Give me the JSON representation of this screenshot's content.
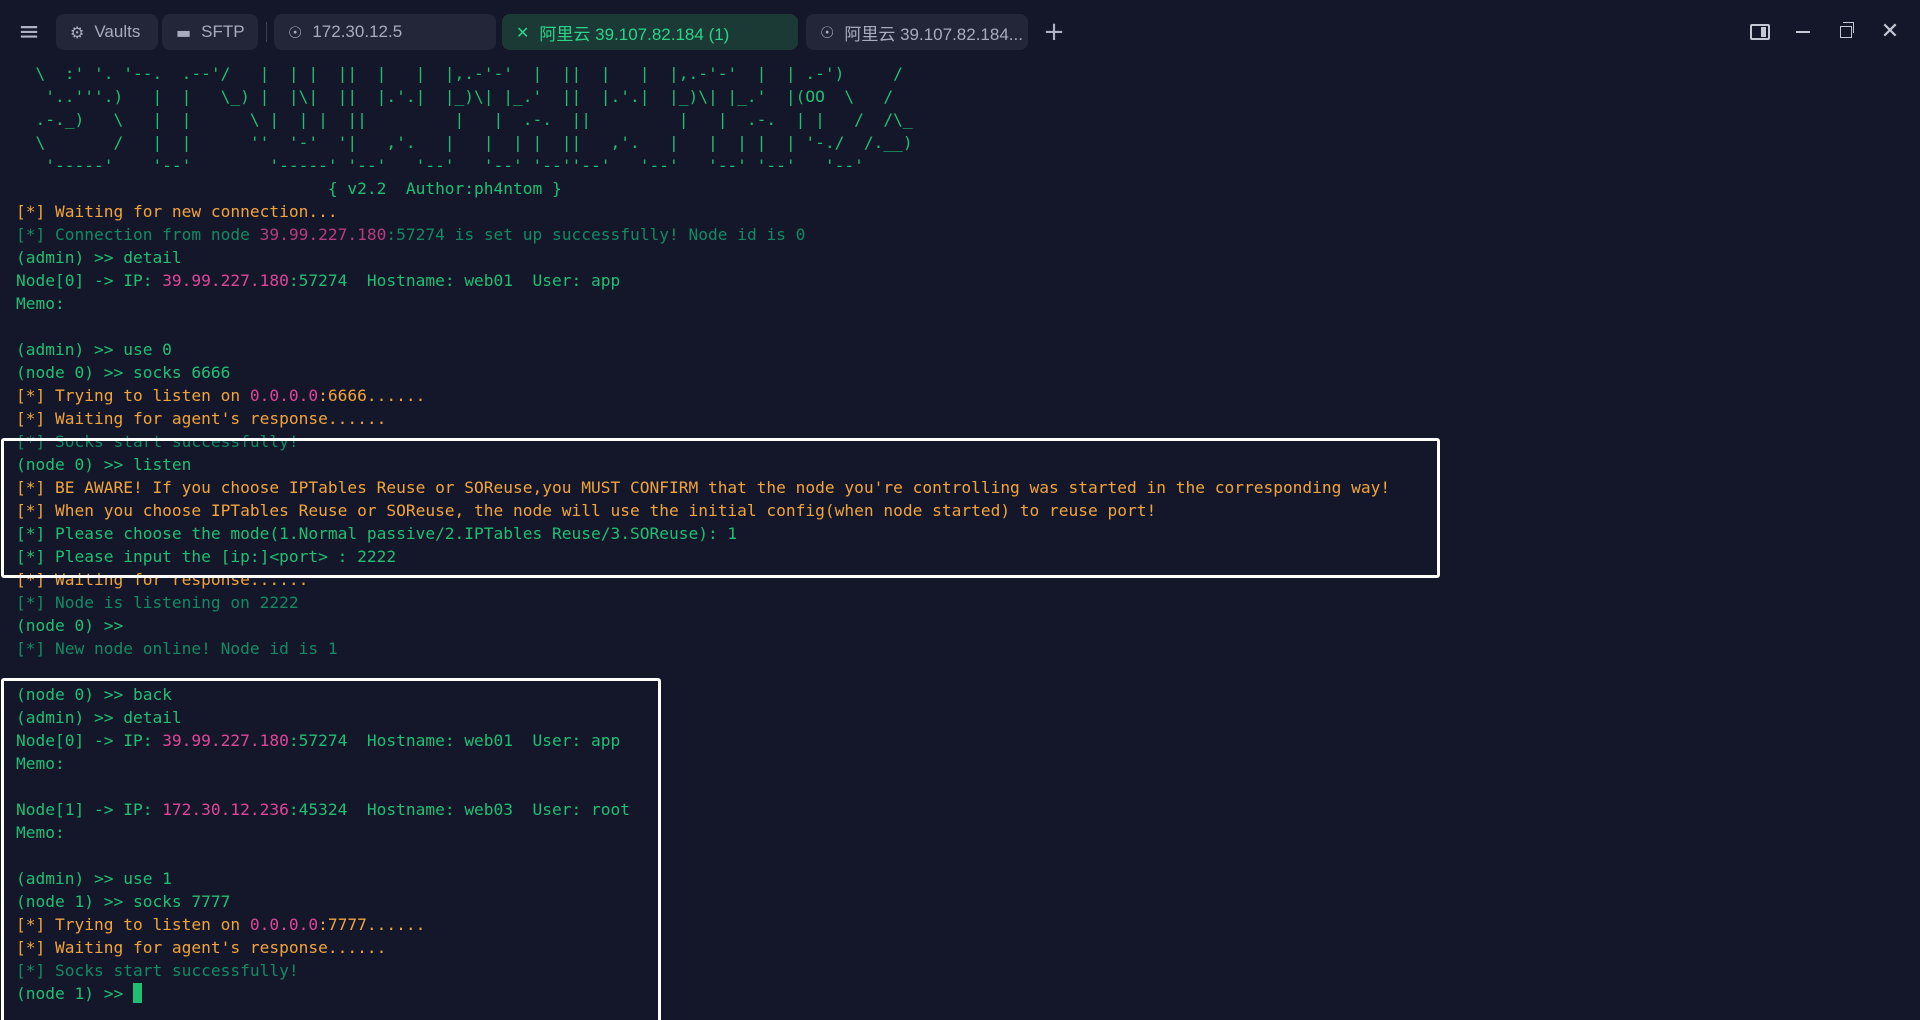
{
  "tabs": [
    {
      "label": "Vaults",
      "icon": "vault-icon"
    },
    {
      "label": "SFTP",
      "icon": "folder-icon"
    },
    {
      "label": "172.30.12.5",
      "icon": "linux-icon"
    },
    {
      "label": "阿里云 39.107.82.184 (1)",
      "icon": "close-icon",
      "active": true
    },
    {
      "label": "阿里云 39.107.82.184...",
      "icon": "linux-icon"
    }
  ],
  "banner": [
    "  \\  :' '. '--.  .--'/   |  | |  ||  |   |  |,.-'-'  |  ||  |   |  |,.-'-'  |  | .-')     /",
    "   '..'''.)   |  |   \\_) |  |\\|  ||  |.'.|  |_)\\| |_.'  ||  |.'.|  |_)\\| |_.'  |(OO  \\   /",
    "  .-._)   \\   |  |      \\ |  | |  ||         |   |  .-.  ||         |   |  .-.  | |   /  /\\_",
    "  \\       /   |  |      ''  '-'  '|   ,'.   |   |  | |  ||   ,'.   |   |  | |  | '-./  /.__)",
    "   '-----'    '--'        '-----' '--'   '--'   '--' '--''--'   '--'   '--' '--'   '--'"
  ],
  "version_line": "                                { v2.2  Author:ph4ntom }",
  "lines": [
    {
      "segments": [
        {
          "t": "[*] Waiting for new connection...",
          "c": "warn"
        }
      ]
    },
    {
      "segments": [
        {
          "t": "[*] Connection from node ",
          "c": "dim"
        },
        {
          "t": "39.99.227.180",
          "c": "ip-dim"
        },
        {
          "t": ":57274 is set up successfully! Node id is 0",
          "c": "dim"
        }
      ]
    },
    {
      "segments": [
        {
          "t": "(admin) >> detail",
          "c": ""
        }
      ]
    },
    {
      "segments": [
        {
          "t": "Node[0] -> IP: ",
          "c": ""
        },
        {
          "t": "39.99.227.180",
          "c": "ip"
        },
        {
          "t": ":57274  Hostname: web01  User: app",
          "c": ""
        }
      ]
    },
    {
      "segments": [
        {
          "t": "Memo:",
          "c": ""
        }
      ]
    },
    {
      "segments": [
        {
          "t": "",
          "c": ""
        }
      ]
    },
    {
      "segments": [
        {
          "t": "(admin) >> use 0",
          "c": ""
        }
      ]
    },
    {
      "segments": [
        {
          "t": "(node 0) >> socks 6666",
          "c": ""
        }
      ]
    },
    {
      "segments": [
        {
          "t": "[*] Trying to listen on ",
          "c": "warn"
        },
        {
          "t": "0.0.0.0",
          "c": "addr"
        },
        {
          "t": ":6666......",
          "c": "warn"
        }
      ]
    },
    {
      "segments": [
        {
          "t": "[*] Waiting for agent's response......",
          "c": "warn"
        }
      ]
    },
    {
      "segments": [
        {
          "t": "[*] Socks start successfully!",
          "c": "dim"
        }
      ]
    },
    {
      "segments": [
        {
          "t": "(node 0) >> listen",
          "c": ""
        }
      ]
    },
    {
      "segments": [
        {
          "t": "[*] BE AWARE! If you choose IPTables Reuse or SOReuse,you MUST CONFIRM that the node you're controlling was started in the corresponding way!",
          "c": "warn"
        }
      ]
    },
    {
      "segments": [
        {
          "t": "[*] When you choose IPTables Reuse or SOReuse, the node will use the initial config(when node started) to reuse port!",
          "c": "warn"
        }
      ]
    },
    {
      "segments": [
        {
          "t": "[*] Please choose the mode(1.Normal passive/2.IPTables Reuse/3.SOReuse): 1",
          "c": ""
        }
      ]
    },
    {
      "segments": [
        {
          "t": "[*] Please input the [ip:]<port> : 2222",
          "c": ""
        }
      ]
    },
    {
      "segments": [
        {
          "t": "[*] Waiting for response......",
          "c": "warn"
        }
      ]
    },
    {
      "segments": [
        {
          "t": "[*] Node is listening on 2222",
          "c": "dim"
        }
      ]
    },
    {
      "segments": [
        {
          "t": "(node 0) >>",
          "c": ""
        }
      ]
    },
    {
      "segments": [
        {
          "t": "[*] New node online! Node id is 1",
          "c": "dim"
        }
      ]
    },
    {
      "segments": [
        {
          "t": "",
          "c": ""
        }
      ]
    },
    {
      "segments": [
        {
          "t": "(node 0) >> back",
          "c": ""
        }
      ]
    },
    {
      "segments": [
        {
          "t": "(admin) >> detail",
          "c": ""
        }
      ]
    },
    {
      "segments": [
        {
          "t": "Node[0] -> IP: ",
          "c": ""
        },
        {
          "t": "39.99.227.180",
          "c": "ip"
        },
        {
          "t": ":57274  Hostname: web01  User: app",
          "c": ""
        }
      ]
    },
    {
      "segments": [
        {
          "t": "Memo:",
          "c": ""
        }
      ]
    },
    {
      "segments": [
        {
          "t": "",
          "c": ""
        }
      ]
    },
    {
      "segments": [
        {
          "t": "Node[1] -> IP: ",
          "c": ""
        },
        {
          "t": "172.30.12.236",
          "c": "ip"
        },
        {
          "t": ":45324  Hostname: web03  User: root",
          "c": ""
        }
      ]
    },
    {
      "segments": [
        {
          "t": "Memo:",
          "c": ""
        }
      ]
    },
    {
      "segments": [
        {
          "t": "",
          "c": ""
        }
      ]
    },
    {
      "segments": [
        {
          "t": "(admin) >> use 1",
          "c": ""
        }
      ]
    },
    {
      "segments": [
        {
          "t": "(node 1) >> socks 7777",
          "c": ""
        }
      ]
    },
    {
      "segments": [
        {
          "t": "[*] Trying to listen on ",
          "c": "warn"
        },
        {
          "t": "0.0.0.0",
          "c": "addr"
        },
        {
          "t": ":7777......",
          "c": "warn"
        }
      ]
    },
    {
      "segments": [
        {
          "t": "[*] Waiting for agent's response......",
          "c": "warn"
        }
      ]
    },
    {
      "segments": [
        {
          "t": "[*] Socks start successfully!",
          "c": "dim"
        }
      ]
    }
  ],
  "prompt": "(node 1) >> ",
  "colors": {
    "background": "#141729",
    "text": "#1fbf73",
    "warning": "#f0a43c",
    "ip": "#e0459a",
    "active_tab": "#2bd48a"
  }
}
